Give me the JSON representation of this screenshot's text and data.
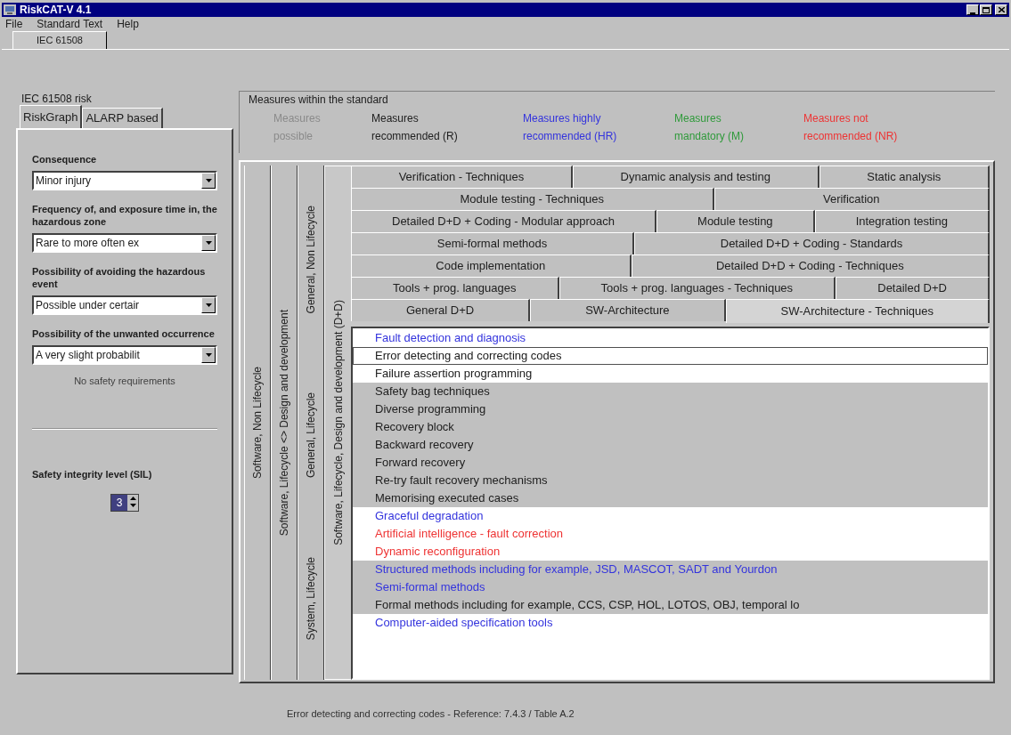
{
  "window": {
    "title": "RiskCAT-V 4.1"
  },
  "menu": [
    "File",
    "Standard Text",
    "Help"
  ],
  "top_tabs": [
    {
      "label": "IEC 61508",
      "selected": true
    }
  ],
  "risk_panel": {
    "title": "IEC 61508 risk",
    "tabs": [
      {
        "label": "RiskGraph",
        "selected": true
      },
      {
        "label": "ALARP based",
        "selected": false
      }
    ],
    "fields": [
      {
        "label": "Consequence",
        "value": "Minor injury"
      },
      {
        "label": "Frequency of, and exposure time in, the hazardous zone",
        "value": "Rare to more often ex"
      },
      {
        "label": "Possibility of avoiding the hazardous event",
        "value": "Possible under certair"
      },
      {
        "label": "Possibility of the unwanted occurrence",
        "value": "A very slight probabilit"
      }
    ],
    "result": "No safety requirements",
    "sil": {
      "label": "Safety integrity level (SIL)",
      "value": "3"
    }
  },
  "legend": {
    "title": "Measures within the standard",
    "items": [
      {
        "lines": [
          "Measures",
          "possible"
        ],
        "color": "#8a8a8a"
      },
      {
        "lines": [
          "Measures",
          "recommended (R)"
        ],
        "color": "#202020"
      },
      {
        "lines": [
          "Measures highly",
          "recommended (HR)"
        ],
        "color": "#3333dd"
      },
      {
        "lines": [
          "Measures",
          "mandatory (M)"
        ],
        "color": "#2f9a3a"
      },
      {
        "lines": [
          "Measures not",
          "recommended (NR)"
        ],
        "color": "#ee3333"
      }
    ]
  },
  "vertical_tabs": [
    {
      "tabs": [
        {
          "label": "Software, Non Lifecycle",
          "selected": false
        }
      ]
    },
    {
      "tabs": [
        {
          "label": "Software, Lifecycle <> Design and development",
          "selected": false
        }
      ]
    },
    {
      "tabs": [
        {
          "label": "System, Lifecycle",
          "selected": false
        },
        {
          "label": "General, Lifecycle",
          "selected": false
        },
        {
          "label": "General, Non Lifecycle",
          "selected": false
        }
      ]
    },
    {
      "tabs": [
        {
          "label": "Software, Lifecycle, Design and development (D+D)",
          "selected": true
        }
      ]
    }
  ],
  "tab_rows": [
    [
      {
        "label": "Verification - Techniques",
        "selected": false
      },
      {
        "label": "Dynamic analysis and testing",
        "selected": false
      },
      {
        "label": "Static analysis",
        "selected": false
      }
    ],
    [
      {
        "label": "Module testing - Techniques",
        "selected": false
      },
      {
        "label": "Verification",
        "selected": false
      }
    ],
    [
      {
        "label": "Detailed D+D + Coding - Modular approach",
        "selected": false
      },
      {
        "label": "Module testing",
        "selected": false
      },
      {
        "label": "Integration testing",
        "selected": false
      }
    ],
    [
      {
        "label": "Semi-formal methods",
        "selected": false
      },
      {
        "label": "Detailed D+D + Coding - Standards",
        "selected": false
      }
    ],
    [
      {
        "label": "Code implementation",
        "selected": false
      },
      {
        "label": "Detailed D+D + Coding - Techniques",
        "selected": false
      }
    ],
    [
      {
        "label": "Tools + prog. languages",
        "selected": false
      },
      {
        "label": "Tools + prog. languages - Techniques",
        "selected": false
      },
      {
        "label": "Detailed D+D",
        "selected": false
      }
    ],
    [
      {
        "label": "General D+D",
        "selected": false
      },
      {
        "label": "SW-Architecture",
        "selected": false
      },
      {
        "label": "SW-Architecture - Techniques",
        "selected": true
      }
    ]
  ],
  "measures": [
    {
      "label": "Fault detection and diagnosis",
      "color": "#3333dd",
      "shaded": false,
      "selected": false
    },
    {
      "label": "Error detecting and correcting codes",
      "color": "#202020",
      "shaded": false,
      "selected": true
    },
    {
      "label": "Failure assertion programming",
      "color": "#202020",
      "shaded": false,
      "selected": false
    },
    {
      "label": "Safety bag techniques",
      "color": "#202020",
      "shaded": true,
      "selected": false
    },
    {
      "label": "Diverse programming",
      "color": "#202020",
      "shaded": true,
      "selected": false
    },
    {
      "label": "Recovery block",
      "color": "#202020",
      "shaded": true,
      "selected": false
    },
    {
      "label": "Backward recovery",
      "color": "#202020",
      "shaded": true,
      "selected": false
    },
    {
      "label": "Forward recovery",
      "color": "#202020",
      "shaded": true,
      "selected": false
    },
    {
      "label": "Re-try fault recovery mechanisms",
      "color": "#202020",
      "shaded": true,
      "selected": false
    },
    {
      "label": "Memorising executed cases",
      "color": "#202020",
      "shaded": true,
      "selected": false
    },
    {
      "label": "Graceful degradation",
      "color": "#3333dd",
      "shaded": false,
      "selected": false
    },
    {
      "label": "Artificial intelligence - fault correction",
      "color": "#ee3333",
      "shaded": false,
      "selected": false
    },
    {
      "label": "Dynamic reconfiguration",
      "color": "#ee3333",
      "shaded": false,
      "selected": false
    },
    {
      "label": "Structured methods including for example, JSD, MASCOT, SADT and Yourdon",
      "color": "#3333dd",
      "shaded": true,
      "selected": false
    },
    {
      "label": "Semi-formal methods",
      "color": "#3333dd",
      "shaded": true,
      "selected": false
    },
    {
      "label": "Formal methods including for example, CCS, CSP, HOL, LOTOS, OBJ, temporal lo",
      "color": "#202020",
      "shaded": true,
      "selected": false
    },
    {
      "label": "Computer-aided specification tools",
      "color": "#3333dd",
      "shaded": false,
      "selected": false
    }
  ],
  "status_bar": "Error detecting and correcting codes - Reference: 7.4.3 / Table A.2"
}
